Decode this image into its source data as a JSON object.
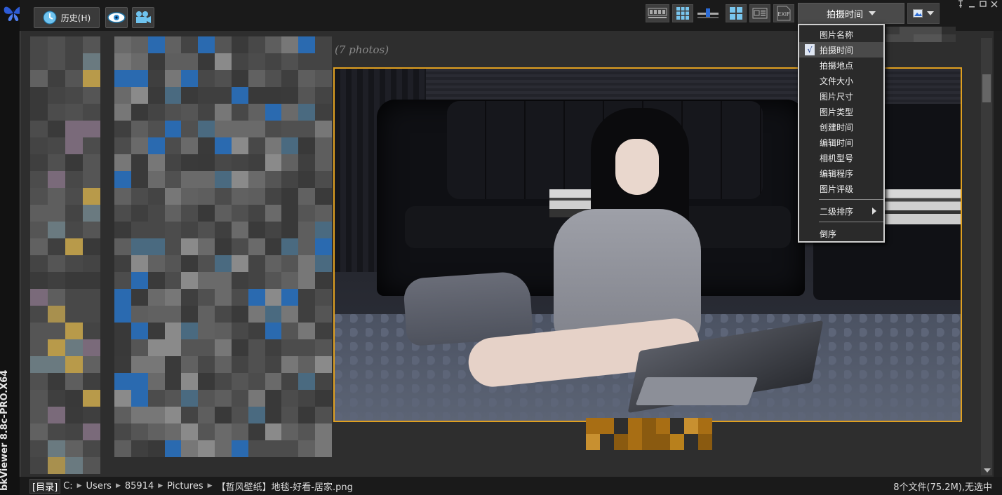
{
  "app": {
    "title": "bkViewer 8.8c-PRO.X64",
    "logo_icon": "butterfly-icon"
  },
  "toolbar": {
    "history_label": "历史(H)",
    "history_icon": "clock-icon",
    "view_icon": "eye-icon",
    "slideshow_icon": "camera-icon",
    "sort_label": "拍摄时间",
    "layout_icons": [
      "filmstrip-icon",
      "grid-9-icon",
      "slider-icon",
      "grid-4-icon",
      "info-panel-icon",
      "exif-icon"
    ],
    "exif_label": "EXIF",
    "image-view-icon": "image-icon"
  },
  "window_controls": [
    "pin-icon",
    "minimize-icon",
    "maximize-icon",
    "close-icon"
  ],
  "gallery": {
    "photo_count": "(7 photos)"
  },
  "sort_menu": {
    "items": [
      {
        "label": "图片名称",
        "checked": false
      },
      {
        "label": "拍摄时间",
        "checked": true
      },
      {
        "label": "拍摄地点",
        "checked": false
      },
      {
        "label": "文件大小",
        "checked": false
      },
      {
        "label": "图片尺寸",
        "checked": false
      },
      {
        "label": "图片类型",
        "checked": false
      },
      {
        "label": "创建时间",
        "checked": false
      },
      {
        "label": "编辑时间",
        "checked": false
      },
      {
        "label": "相机型号",
        "checked": false
      },
      {
        "label": "编辑程序",
        "checked": false
      },
      {
        "label": "图片评级",
        "checked": false
      }
    ],
    "secondary_sort": "二级排序",
    "reverse": "倒序",
    "check_mark": "√"
  },
  "statusbar": {
    "dir_tag": "[目录]",
    "path": [
      "C:",
      "Users",
      "85914",
      "Pictures",
      "【哲风壁纸】地毯-好看-居家.png"
    ],
    "summary": "8个文件(75.2M),无选中"
  },
  "colors": {
    "selection_border": "#e0a020",
    "background": "#2e2e2e",
    "menu_border": "#cfcfcf"
  }
}
